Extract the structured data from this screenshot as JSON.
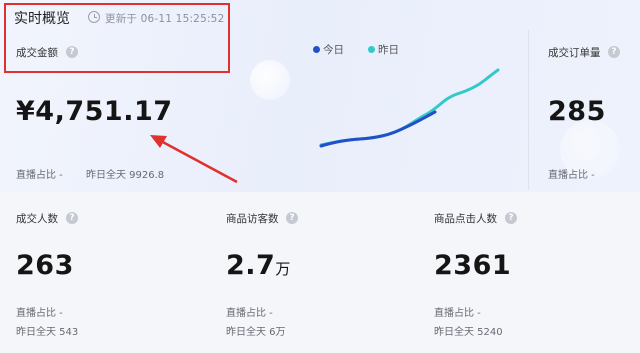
{
  "header": {
    "title": "实时概览",
    "update_text": "更新于 06-11 15:25:52"
  },
  "legend": {
    "today": "今日",
    "yesterday": "昨日",
    "today_color": "#2350c8",
    "yesterday_color": "#34c9c9"
  },
  "metrics": {
    "gmv": {
      "label": "成交金额",
      "value": "¥4,751.17",
      "live_ratio": "直播占比 -",
      "yesterday": "昨日全天 9926.8"
    },
    "orders": {
      "label": "成交订单量",
      "value": "285",
      "live_ratio": "直播占比 -"
    },
    "buyers": {
      "label": "成交人数",
      "value": "263",
      "live_ratio": "直播占比 -",
      "yesterday": "昨日全天 543"
    },
    "visitors": {
      "label": "商品访客数",
      "value": "2.7",
      "unit": "万",
      "live_ratio": "直播占比 -",
      "yesterday": "昨日全天 6万"
    },
    "clicks": {
      "label": "商品点击人数",
      "value": "2361",
      "live_ratio": "直播占比 -",
      "yesterday": "昨日全天 5240"
    }
  },
  "annotation": {
    "highlight_color": "#e0312e"
  },
  "help_glyph": "?"
}
